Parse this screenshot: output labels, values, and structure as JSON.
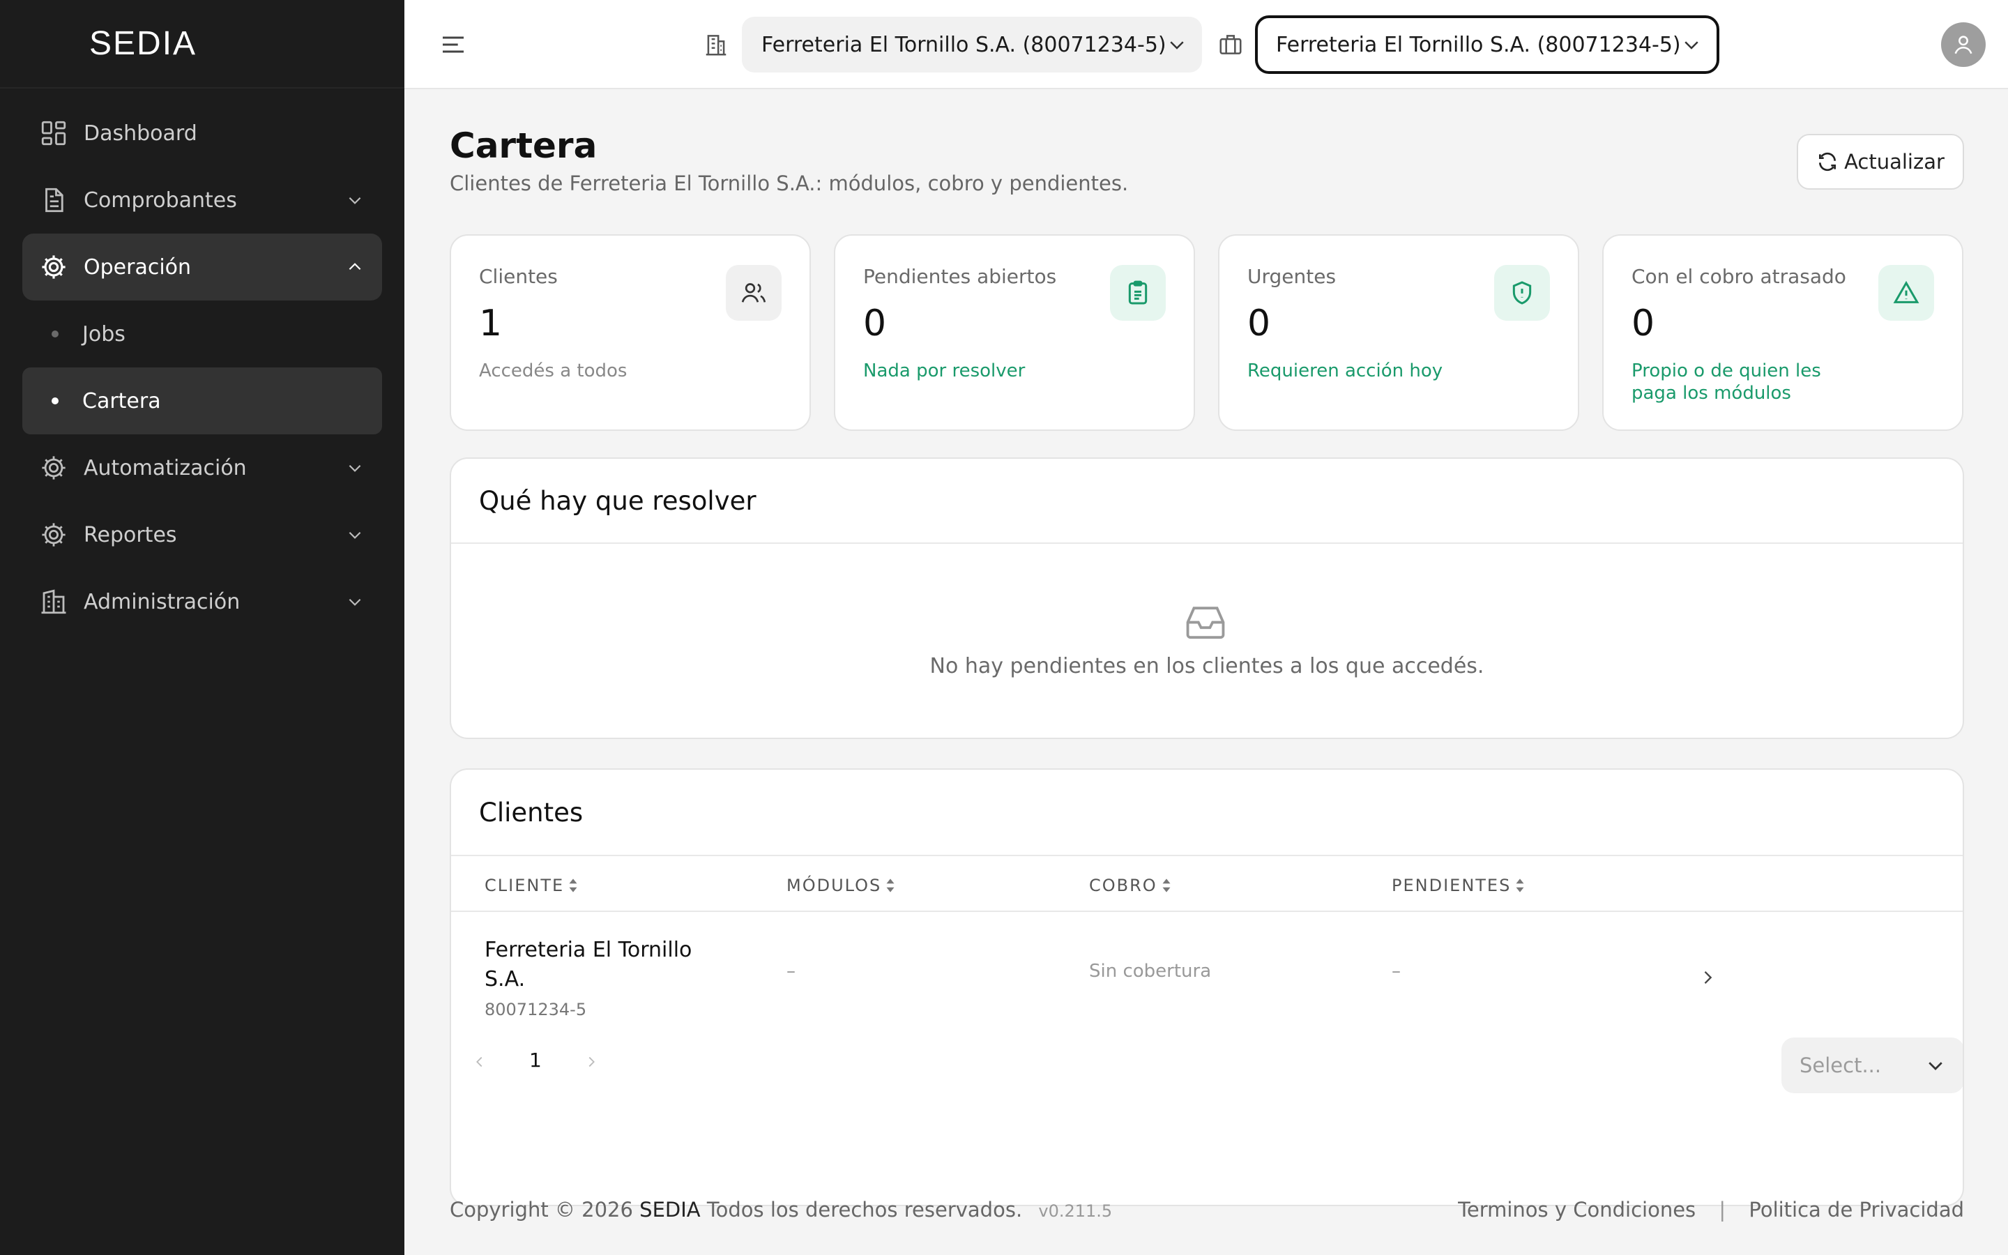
{
  "app": {
    "brand": "SEDIA"
  },
  "sidebar": {
    "items": [
      {
        "label": "Dashboard",
        "icon": "dashboard-icon"
      },
      {
        "label": "Comprobantes",
        "icon": "document-icon"
      },
      {
        "label": "Operación",
        "icon": "gear-icon",
        "expanded": true,
        "children": [
          {
            "label": "Jobs"
          },
          {
            "label": "Cartera",
            "active": true
          }
        ]
      },
      {
        "label": "Automatización",
        "icon": "gear-icon"
      },
      {
        "label": "Reportes",
        "icon": "gear-icon"
      },
      {
        "label": "Administración",
        "icon": "building-icon"
      }
    ]
  },
  "topbar": {
    "company_select": "Ferreteria El Tornillo S.A. (80071234-5)",
    "client_select": "Ferreteria El Tornillo S.A. (80071234-5)"
  },
  "page": {
    "title": "Cartera",
    "subtitle": "Clientes de Ferreteria El Tornillo S.A.: módulos, cobro y pendientes.",
    "refresh_label": "Actualizar"
  },
  "cards": [
    {
      "title": "Clientes",
      "value": "1",
      "note": "Accedés a todos",
      "icon": "users-icon"
    },
    {
      "title": "Pendientes abiertos",
      "value": "0",
      "note": "Nada por resolver",
      "icon": "clipboard-icon"
    },
    {
      "title": "Urgentes",
      "value": "0",
      "note": "Requieren acción hoy",
      "icon": "shield-icon"
    },
    {
      "title": "Con el cobro atrasado",
      "value": "0",
      "note": "Propio o de quien les paga los módulos",
      "icon": "warning-icon"
    }
  ],
  "pending": {
    "title": "Qué hay que resolver",
    "empty_message": "No hay pendientes en los clientes a los que accedés."
  },
  "clients": {
    "title": "Clientes",
    "columns": [
      "CLIENTE",
      "MÓDULOS",
      "COBRO",
      "PENDIENTES"
    ],
    "rows": [
      {
        "name": "Ferreteria El Tornillo S.A.",
        "id": "80071234-5",
        "modules": "–",
        "billing": "Sin cobertura",
        "pending": "–"
      }
    ],
    "pagination": {
      "current_page": "1",
      "page_size_placeholder": "Select..."
    }
  },
  "footer": {
    "copyright": "Copyright © 2026",
    "brand": "SEDIA",
    "rights": "Todos los derechos reservados.",
    "version": "v0.211.5",
    "terms": "Terminos y Condiciones",
    "separator": "|",
    "privacy": "Politica de Privacidad"
  },
  "colors": {
    "accent_green": "#1a9a6b",
    "sidebar_bg": "#1c1c1c",
    "page_bg": "#f4f4f4"
  }
}
